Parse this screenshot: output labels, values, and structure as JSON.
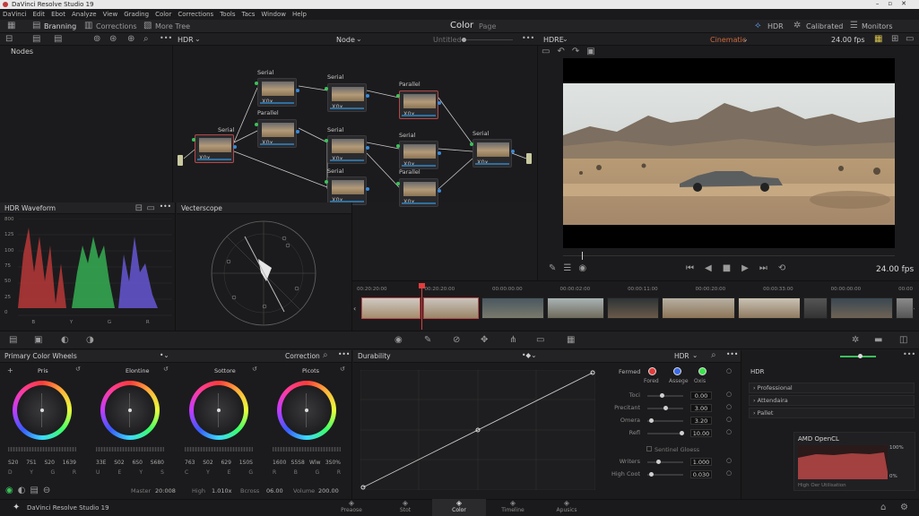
{
  "app_title": "DaVinci Resolve Studio 19",
  "menu": [
    "DaVinci",
    "Edit",
    "Ebot",
    "Analyze",
    "View",
    "Grading",
    "Color",
    "Corrections",
    "Tools",
    "Tacs",
    "Window",
    "Help"
  ],
  "toolbar": {
    "branching": "Branning",
    "corrections": "Corrections",
    "more_tree": "More Tree",
    "page_title": "Color",
    "page_sub": "Page",
    "hdr": "HDR",
    "calibrated": "Calibrated",
    "monitors": "Monitors"
  },
  "node_toolbar": {
    "hdr": "HDR",
    "node": "Node",
    "untitled": "Untitled",
    "hdre": "HDRE",
    "cinematic": "Cinematic",
    "fps": "24.00 fps"
  },
  "node_editor": {
    "title": "Nodes",
    "nodes": [
      {
        "title": "Serial",
        "label": "X0x"
      },
      {
        "title": "Serial",
        "label": "X0x"
      },
      {
        "title": "Parallel",
        "label": "X0x"
      },
      {
        "title": "Serial",
        "label": "X0x"
      },
      {
        "title": "Serial",
        "label": "X0x"
      },
      {
        "title": "Serial",
        "label": "X0x"
      },
      {
        "title": "Parallel",
        "label": "X0x"
      },
      {
        "title": "Serial",
        "label": "X0x"
      },
      {
        "title": "Parallel",
        "label": "X0x"
      },
      {
        "title": "Serial",
        "label": "X0x"
      }
    ]
  },
  "waveform": {
    "title": "HDR Waveform",
    "scale": [
      "800",
      "125",
      "100",
      "75",
      "50",
      "25",
      "0"
    ],
    "channels": [
      "B",
      "Y",
      "G",
      "R"
    ]
  },
  "vectorscope": {
    "title": "Vecterscope"
  },
  "viewer": {
    "fps": "24.00 fps"
  },
  "timeline": {
    "timecodes": [
      "00:20:20:00",
      "00:20:20:00",
      "00:00:00:00",
      "00:00:02:00",
      "00:00:11:00",
      "00:00:20:00",
      "00:00:33:00",
      "00:00:00:00",
      "00:00"
    ]
  },
  "color_wheels": {
    "title": "Primary Color Wheels",
    "mode": "Correction",
    "wheels": [
      {
        "name": "Pris",
        "values": [
          "S20",
          "7S1",
          "S20",
          "1639"
        ],
        "channels": [
          "D",
          "Y",
          "G",
          "R"
        ]
      },
      {
        "name": "Elontine",
        "values": [
          "33E",
          "S02",
          "6S0",
          "S680"
        ],
        "channels": [
          "U",
          "E",
          "Y",
          "S"
        ]
      },
      {
        "name": "Sottore",
        "values": [
          "763",
          "S02",
          "629",
          "1S0S"
        ],
        "channels": [
          "C",
          "Y",
          "E",
          "G"
        ]
      },
      {
        "name": "Picots",
        "values": [
          "1600",
          "S5S8",
          "Wlw",
          "3S0%"
        ],
        "channels": [
          "R",
          "B",
          "G",
          "R"
        ]
      }
    ],
    "footer": {
      "master_label": "Master",
      "master_value": "20:008",
      "high_label": "High",
      "high_value": "1.010x",
      "bcross_label": "Bcross",
      "bcross_value": "06.00",
      "volume_label": "Volume",
      "volume_value": "200.00"
    }
  },
  "curves": {
    "title": "Durability",
    "hdr": "HDR"
  },
  "params": {
    "swatches": [
      {
        "label": "Fored",
        "color": "#e53a3a"
      },
      {
        "label": "Assege",
        "color": "#3a6ae5"
      },
      {
        "label": "Oxis",
        "color": "#3ae54a"
      }
    ],
    "fermed": "Fermed",
    "rows": [
      {
        "label": "Toci",
        "value": "0.00"
      },
      {
        "label": "Precitant",
        "value": "3.00"
      },
      {
        "label": "Omera",
        "value": "3.20"
      },
      {
        "label": "Refl",
        "value": "10.00"
      }
    ],
    "checkbox": "Sentinel Gloess",
    "rows2": [
      {
        "label": "Writers",
        "value": "1.000"
      },
      {
        "label": "High Coot",
        "value": "0.030"
      }
    ]
  },
  "hdr_panel": {
    "title": "HDR",
    "items": [
      "Professional",
      "Attendaira",
      "Pallet"
    ]
  },
  "opencl": {
    "title": "AMD OpenCL",
    "top": "100%",
    "bottom": "0%",
    "footer": "High Oer Utilisation"
  },
  "pages": [
    "Preaose",
    "Stot",
    "Color",
    "Timeline",
    "Apusics"
  ],
  "status": {
    "app": "DaVinci Resolve Studio 19"
  }
}
